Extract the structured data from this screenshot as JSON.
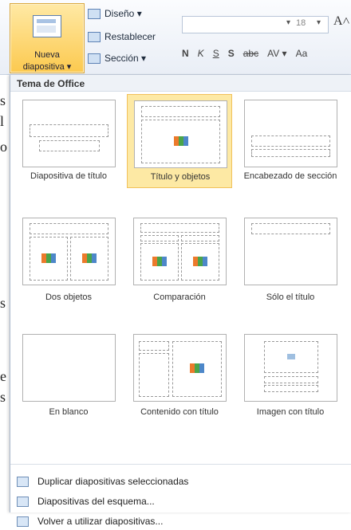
{
  "ribbon": {
    "new_slide": {
      "line1": "Nueva",
      "line2": "diapositiva ▾"
    },
    "layout_button": "Diseño ▾",
    "reset_button": "Restablecer",
    "section_button": "Sección ▾",
    "font_size": "18",
    "grow_font": "A˄",
    "format_buttons": [
      "N",
      "K",
      "S",
      "S",
      "abc",
      "AV ▾",
      "Aa"
    ]
  },
  "background_fragments": [
    "s",
    "l",
    "o",
    "s",
    "e",
    "s"
  ],
  "gallery": {
    "title": "Tema de Office",
    "layouts": [
      {
        "label": "Diapositiva de título"
      },
      {
        "label": "Título y objetos",
        "selected": true
      },
      {
        "label": "Encabezado de sección"
      },
      {
        "label": "Dos objetos"
      },
      {
        "label": "Comparación"
      },
      {
        "label": "Sólo el título"
      },
      {
        "label": "En blanco"
      },
      {
        "label": "Contenido con título"
      },
      {
        "label": "Imagen con título"
      }
    ]
  },
  "menu": {
    "items": [
      {
        "label": "Duplicar diapositivas seleccionadas",
        "icon": "duplicate-slides-icon"
      },
      {
        "label": "Diapositivas del esquema...",
        "icon": "outline-slides-icon"
      },
      {
        "label": "Volver a utilizar diapositivas...",
        "icon": "reuse-slides-icon"
      }
    ]
  }
}
